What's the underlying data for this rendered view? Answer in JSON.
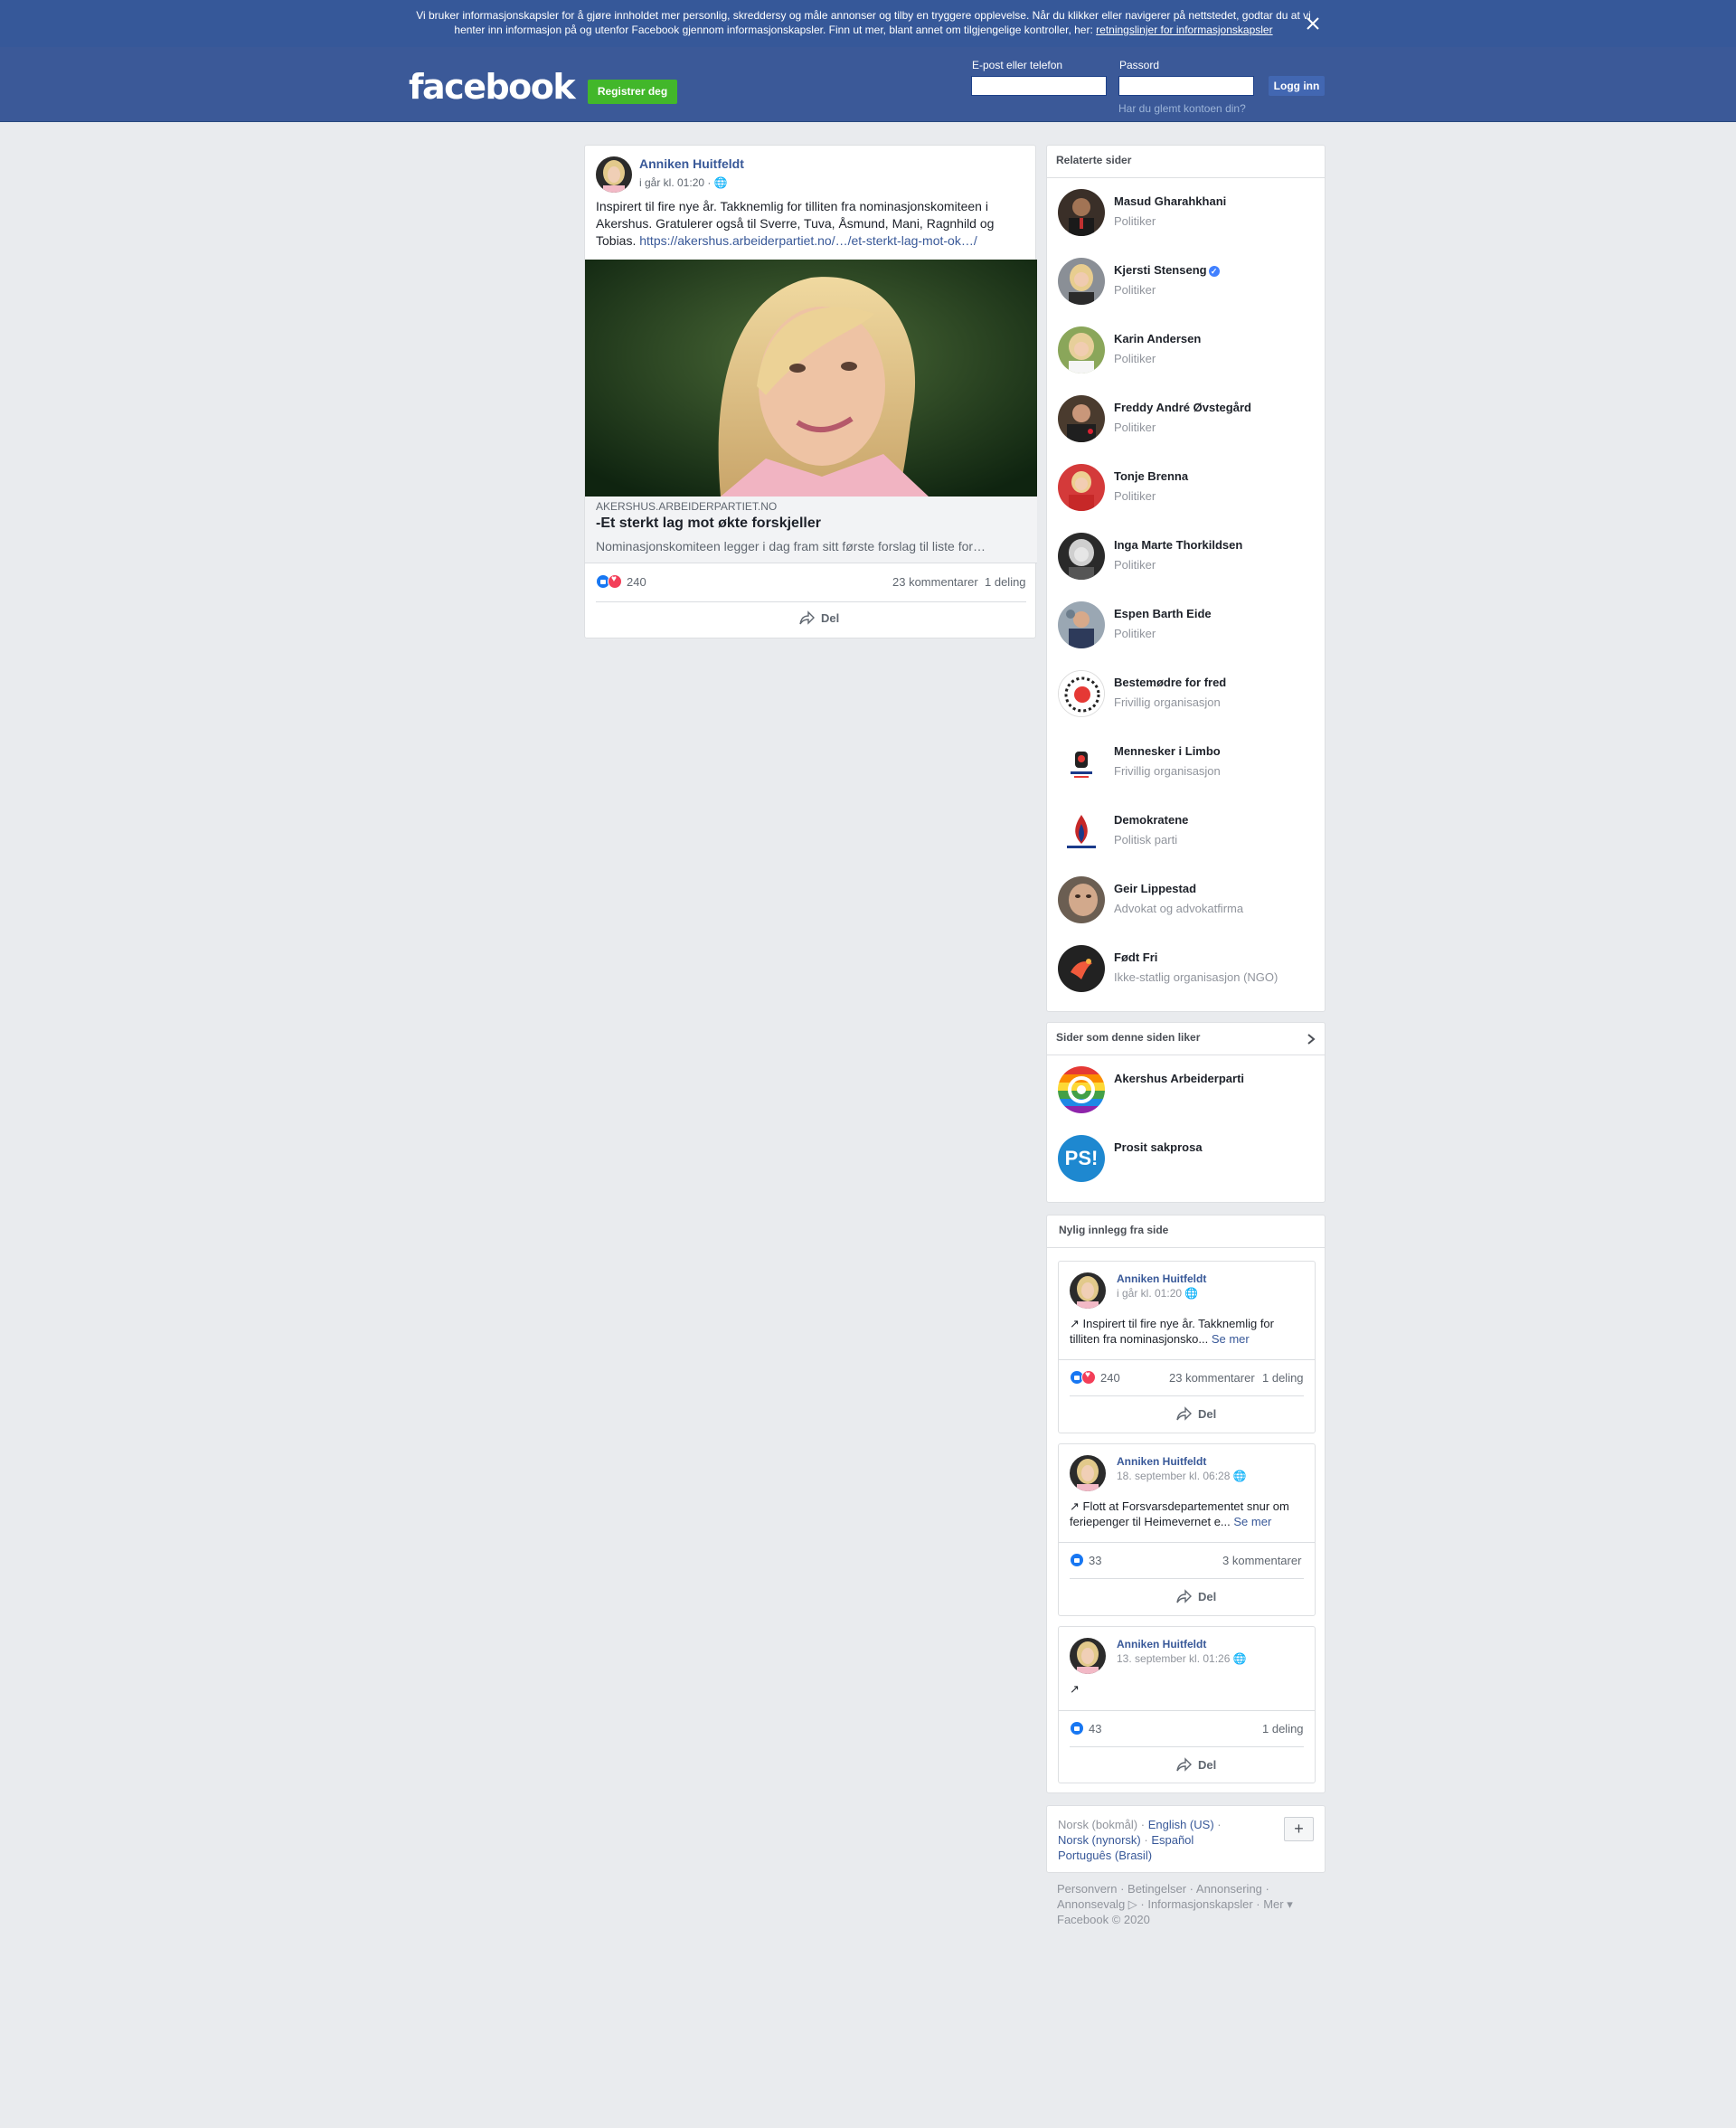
{
  "cookie_banner": {
    "text": "Vi bruker informasjonskapsler for å gjøre innholdet mer personlig, skreddersy og måle annonser og tilby en tryggere opplevelse. Når du klikker eller navigerer på nettstedet, godtar du at vi henter inn informasjon på og utenfor Facebook gjennom informasjonskapsler. Finn ut mer, blant annet om tilgjengelige kontroller, her: ",
    "link": "retningslinjer for informasjonskapsler"
  },
  "header": {
    "logo": "facebook",
    "register": "Registrer deg",
    "email_label": "E-post eller telefon",
    "password_label": "Passord",
    "login": "Logg inn",
    "forgot": "Har du glemt kontoen din?"
  },
  "post": {
    "author": "Anniken Huitfeldt",
    "time": "i går kl. 01:20",
    "text": "Inspirert til fire nye år. Takknemlig for tilliten fra nominasjonskomiteen i Akershus. Gratulerer også til Sverre, Tuva, Åsmund, Mani, Ragnhild og Tobias. ",
    "url": "https://akershus.arbeiderpartiet.no/…/et-sterkt-lag-mot-ok…/",
    "link_domain": "AKERSHUS.ARBEIDERPARTIET.NO",
    "link_title": "-Et sterkt lag mot økte forskjeller",
    "link_desc": "Nominasjonskomiteen legger i dag fram sitt første forslag til liste for…",
    "reactions": "240",
    "comments": "23 kommentarer",
    "shares": "1 deling",
    "share_label": "Del"
  },
  "related": {
    "title": "Relaterte sider",
    "items": [
      {
        "name": "Masud Gharahkhani",
        "category": "Politiker"
      },
      {
        "name": "Kjersti Stenseng",
        "category": "Politiker"
      },
      {
        "name": "Karin Andersen",
        "category": "Politiker"
      },
      {
        "name": "Freddy André Øvstegård",
        "category": "Politiker"
      },
      {
        "name": "Tonje Brenna",
        "category": "Politiker"
      },
      {
        "name": "Inga Marte Thorkildsen",
        "category": "Politiker"
      },
      {
        "name": "Espen Barth Eide",
        "category": "Politiker"
      },
      {
        "name": "Bestemødre for fred",
        "category": "Frivillig organisasjon"
      },
      {
        "name": "Mennesker i Limbo",
        "category": "Frivillig organisasjon"
      },
      {
        "name": "Demokratene",
        "category": "Politisk parti"
      },
      {
        "name": "Geir Lippestad",
        "category": "Advokat og advokatfirma"
      },
      {
        "name": "Født Fri",
        "category": "Ikke-statlig organisasjon (NGO)"
      }
    ]
  },
  "liked": {
    "title": "Sider som denne siden liker",
    "items": [
      {
        "name": "Akershus Arbeiderparti"
      },
      {
        "name": "Prosit sakprosa",
        "logo_text": "PS!"
      }
    ]
  },
  "recent": {
    "title": "Nylig innlegg fra side",
    "posts": [
      {
        "author": "Anniken Huitfeldt",
        "time": "i går kl. 01:20",
        "text": "Inspirert til fire nye år. Takknemlig for tilliten fra nominasjonsko...",
        "see_more": "Se mer",
        "reactions": "240",
        "comments": "23 kommentarer",
        "shares": "1 deling",
        "share_label": "Del"
      },
      {
        "author": "Anniken Huitfeldt",
        "time": "18. september kl. 06:28",
        "text": "Flott at Forsvarsdepartementet snur om feriepenger til Heimevernet e...",
        "see_more": "Se mer",
        "reactions": "33",
        "comments": "3 kommentarer",
        "shares": "",
        "share_label": "Del"
      },
      {
        "author": "Anniken Huitfeldt",
        "time": "13. september kl. 01:26",
        "text": "",
        "see_more": "",
        "reactions": "43",
        "comments": "",
        "shares": "1 deling",
        "share_label": "Del"
      }
    ]
  },
  "languages": {
    "current": "Norsk (bokmål) · ",
    "l1": "English (US)",
    "sep1": " · ",
    "l2": "Norsk (nynorsk)",
    "sep2": " · ",
    "l3": "Español",
    "l4": "Português (Brasil)",
    "plus": "+"
  },
  "footer": {
    "line1": "Personvern · Betingelser · Annonsering ·",
    "line2": "Annonsevalg ▷ · Informasjonskapsler · Mer ▾",
    "line3": "Facebook © 2020"
  },
  "colors": {
    "brand": "#3b5998",
    "banner": "#365899",
    "register": "#42b72a",
    "link": "#385898"
  }
}
